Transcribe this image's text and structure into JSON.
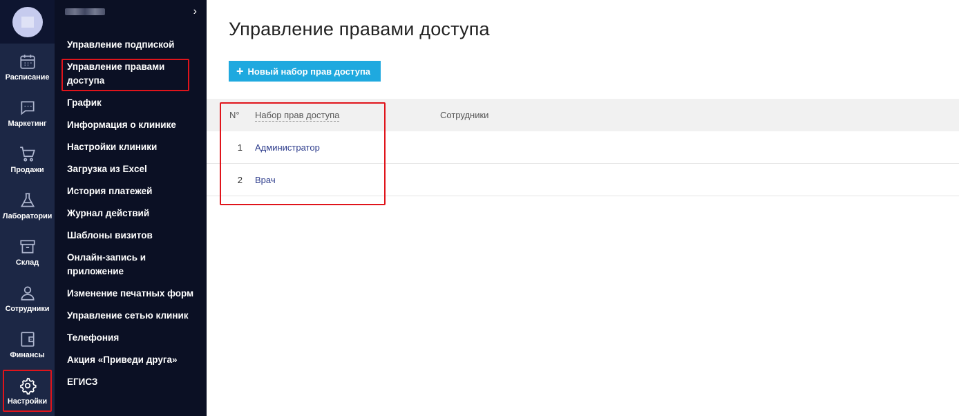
{
  "rail": {
    "items": [
      {
        "label": "Расписание",
        "icon": "calendar-icon"
      },
      {
        "label": "Маркетинг",
        "icon": "chat-icon"
      },
      {
        "label": "Продажи",
        "icon": "cart-icon"
      },
      {
        "label": "Лаборатории",
        "icon": "flask-icon"
      },
      {
        "label": "Склад",
        "icon": "archive-icon"
      },
      {
        "label": "Сотрудники",
        "icon": "user-icon"
      },
      {
        "label": "Финансы",
        "icon": "wallet-icon"
      },
      {
        "label": "Настройки",
        "icon": "gear-icon"
      }
    ],
    "active": "Настройки"
  },
  "submenu": {
    "chevron": "›",
    "items": [
      "Управление подпиской",
      "Управление правами доступа",
      "График",
      "Информация о клинике",
      "Настройки клиники",
      "Загрузка из Excel",
      "История платежей",
      "Журнал действий",
      "Шаблоны визитов",
      "Онлайн-запись и приложение",
      "Изменение печатных форм",
      "Управление сетью клиник",
      "Телефония",
      "Акция «Приведи друга»",
      "ЕГИСЗ"
    ]
  },
  "main": {
    "title": "Управление правами доступа",
    "add_button": "Новый набор прав доступа",
    "table": {
      "headers": {
        "num": "N°",
        "set": "Набор прав доступа",
        "staff": "Сотрудники"
      },
      "rows": [
        {
          "num": "1",
          "name": "Администратор",
          "staff": ""
        },
        {
          "num": "2",
          "name": "Врач",
          "staff": ""
        }
      ]
    }
  },
  "colors": {
    "accent": "#1fa9df",
    "highlight": "#e0141b",
    "rail": "#1c2745",
    "submenu": "#0b1024",
    "link": "#2d3c8c"
  }
}
